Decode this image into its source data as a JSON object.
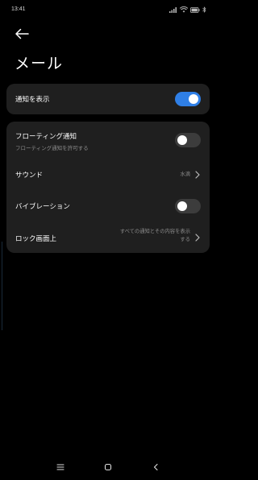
{
  "status_bar": {
    "time": "13:41"
  },
  "header": {
    "title": "メール"
  },
  "card_main": {
    "label": "通知を表示",
    "toggle_on": true
  },
  "settings": {
    "floating": {
      "label": "フローティング通知",
      "sublabel": "フローティング通知を許可する",
      "toggle_on": false
    },
    "sound": {
      "label": "サウンド",
      "value": "水滴"
    },
    "vibration": {
      "label": "バイブレーション",
      "toggle_on": false
    },
    "lockscreen": {
      "label": "ロック画面上",
      "value_line1": "すべての通知とその内容を表示",
      "value_line2": "する"
    }
  },
  "colors": {
    "accent": "#2f7fe6",
    "card_bg": "#1f1f1f",
    "background": "#000000"
  },
  "icons": {
    "back": "arrow-left-icon",
    "menu": "menu-icon",
    "home": "home-icon",
    "back_nav": "back-nav-icon"
  }
}
